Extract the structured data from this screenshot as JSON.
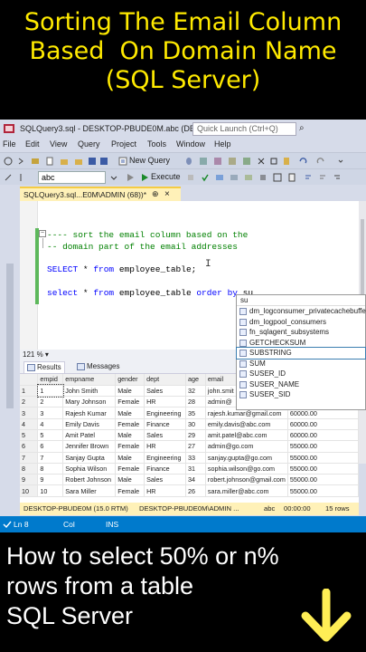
{
  "banner_top": {
    "line1": "Sorting The Email Column",
    "line2": "Based  On Domain Name",
    "line3": "(SQL Server)",
    "color": "#ffea00"
  },
  "window": {
    "title": "SQLQuery3.sql - DESKTOP-PBUDE0M.abc (DE...",
    "quick_launch_placeholder": "Quick Launch (Ctrl+Q)"
  },
  "menu": [
    "File",
    "Edit",
    "View",
    "Query",
    "Project",
    "Tools",
    "Window",
    "Help"
  ],
  "toolbar": {
    "new_query": "New Query",
    "database": "abc",
    "execute": "Execute"
  },
  "doc_tab": {
    "label": "SQLQuery3.sql...E0M\\ADMIN (68))*",
    "pin": "⊕",
    "close": "×"
  },
  "editor": {
    "comment1": "---- sort the email column based on the",
    "comment2": "-- domain part of the email addresses",
    "line1_kw1": "SELECT",
    "line1_mid": " * ",
    "line1_kw2": "from",
    "line1_rest": " employee_table;",
    "line2_kw1": "select",
    "line2_mid": " * ",
    "line2_kw2": "from",
    "line2_rest": " employee_table ",
    "line2_kw3": "order by",
    "line2_tail": " su"
  },
  "intellisense": {
    "filter": "su",
    "items": [
      "dm_logconsumer_privatecachebuffers",
      "dm_logpool_consumers",
      "fn_sqlagent_subsystems",
      "GETCHECKSUM",
      "SUBSTRING",
      "SUM",
      "SUSER_ID",
      "SUSER_NAME",
      "SUSER_SID"
    ],
    "selected_index": 4
  },
  "zoom": "121 %",
  "results_tabs": [
    "Results",
    "Messages"
  ],
  "grid": {
    "columns": [
      "",
      "empid",
      "empname",
      "gender",
      "dept",
      "age",
      "email",
      "salary"
    ],
    "rows": [
      [
        "1",
        "1",
        "John Smith",
        "Male",
        "Sales",
        "32",
        "john.smit",
        ""
      ],
      [
        "2",
        "2",
        "Mary Johnson",
        "Female",
        "HR",
        "28",
        "admin@",
        ""
      ],
      [
        "3",
        "3",
        "Rajesh Kumar",
        "Male",
        "Engineering",
        "35",
        "rajesh.kumar@gmail.com",
        "60000.00"
      ],
      [
        "4",
        "4",
        "Emily Davis",
        "Female",
        "Finance",
        "30",
        "emily.davis@abc.com",
        "60000.00"
      ],
      [
        "5",
        "5",
        "Amit Patel",
        "Male",
        "Sales",
        "29",
        "amit.patel@abc.com",
        "60000.00"
      ],
      [
        "6",
        "6",
        "Jennifer Brown",
        "Female",
        "HR",
        "27",
        "admin@go.com",
        "55000.00"
      ],
      [
        "7",
        "7",
        "Sanjay Gupta",
        "Male",
        "Engineering",
        "33",
        "sanjay.gupta@go.com",
        "55000.00"
      ],
      [
        "8",
        "8",
        "Sophia Wilson",
        "Female",
        "Finance",
        "31",
        "sophia.wilson@go.com",
        "55000.00"
      ],
      [
        "9",
        "9",
        "Robert Johnson",
        "Male",
        "Sales",
        "34",
        "robert.johnson@gmail.com",
        "55000.00"
      ],
      [
        "10",
        "10",
        "Sara Miller",
        "Female",
        "HR",
        "26",
        "sara.miller@abc.com",
        "55000.00"
      ]
    ]
  },
  "result_status": {
    "server": "DESKTOP-PBUDE0M (15.0 RTM)",
    "login": "DESKTOP-PBUDE0M\\ADMIN ...",
    "db": "abc",
    "time": "00:00:00",
    "rows": "15 rows"
  },
  "statusbar": {
    "ln": "Ln 8",
    "col": "Col",
    "ins": "INS"
  },
  "banner_bottom": {
    "line1": "How to select 50% or n%",
    "line2": "rows from a table",
    "line3": "SQL Server",
    "arrow_color": "#ffee55"
  }
}
